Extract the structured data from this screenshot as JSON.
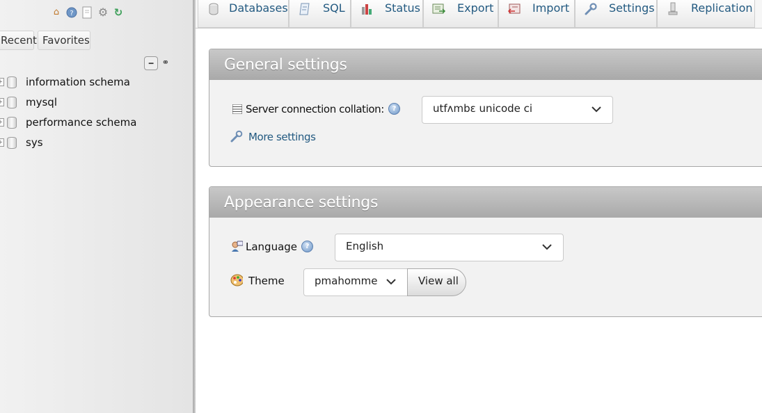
{
  "nav": {
    "logo_icons": [
      "home-icon",
      "help-icon",
      "documentation-icon",
      "gear-icon",
      "reload-icon"
    ],
    "tabs": [
      {
        "label": "Recent"
      },
      {
        "label": "Favorites"
      }
    ],
    "tree_tools": [
      "collapse-all-icon",
      "link-with-main-panel-icon"
    ],
    "databases": [
      {
        "name": "information_schema",
        "label": "information schema"
      },
      {
        "name": "mysql",
        "label": "mysql"
      },
      {
        "name": "performance_schema",
        "label": "performance schema"
      },
      {
        "name": "sys",
        "label": "sys"
      }
    ]
  },
  "topmenu": {
    "tabs": [
      {
        "label": "Databases",
        "icon": "database-icon"
      },
      {
        "label": "SQL",
        "icon": "sql-icon"
      },
      {
        "label": "Status",
        "icon": "status-chart-icon"
      },
      {
        "label": "Export",
        "icon": "export-icon"
      },
      {
        "label": "Import",
        "icon": "import-icon"
      },
      {
        "label": "Settings",
        "icon": "wrench-icon"
      },
      {
        "label": "Replication",
        "icon": "replication-icon"
      }
    ]
  },
  "general": {
    "title": "General settings",
    "collation_label": "Server connection collation:",
    "collation_value": "utfʌmbɛ  unicode  ci",
    "more_settings": "More settings"
  },
  "appearance": {
    "title": "Appearance settings",
    "language_label": "Language",
    "language_value": "English",
    "theme_label": "Theme",
    "theme_value": "pmahomme",
    "view_all": "View all"
  },
  "colors": {
    "link": "#235a81",
    "panel_header": "#b5b5b5",
    "panel_bg": "#f2f2f2"
  }
}
